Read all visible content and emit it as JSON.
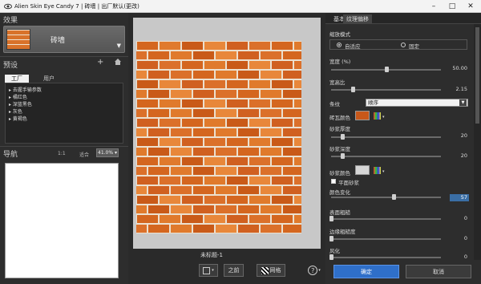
{
  "window": {
    "title": "Alien Skin Eye Candy 7 | 砖墙 | 出厂默认(更改)",
    "icons": [
      "eye-icon",
      "minimize-icon",
      "maximize-icon",
      "close-icon"
    ]
  },
  "left": {
    "effects_title": "效果",
    "effect_name": "砖墙",
    "presets_title": "预设",
    "preset_tabs": [
      "工厂",
      "用户"
    ],
    "preset_items": [
      "去握手输参数",
      "橘红色",
      "深蓝黑色",
      "灰色",
      "黄褐色"
    ],
    "nav_title": "导航",
    "nav_ratio": "1:1",
    "nav_fit": "适合",
    "nav_zoom": "41.0%"
  },
  "center": {
    "canvas_label": "未标题-1",
    "before_label": "之前",
    "grid_label": "网格",
    "help_label": "?"
  },
  "right": {
    "tabs": [
      "基本",
      "纹理偏移"
    ],
    "scale_mode_label": "缩放模式",
    "scale_options": [
      "自适应",
      "固定"
    ],
    "width_label": "宽度 (%)",
    "width_value": "50.00",
    "width_level": 0.5,
    "aspect_label": "宽高比",
    "aspect_value": "2.15",
    "aspect_level": 0.2,
    "pattern_label": "条纹",
    "pattern_value": "顺序",
    "brick_color_label": "砖瓦颜色",
    "brick_color": "#c8581a",
    "mortar_thickness_label": "砂浆厚度",
    "mortar_thickness_value": "20",
    "mortar_thickness_level": 0.1,
    "mortar_depth_label": "砂浆深度",
    "mortar_depth_value": "20",
    "mortar_depth_level": 0.1,
    "mortar_color_label": "砂浆颜色",
    "mortar_color": "#d6d6d6",
    "flat_mortar_label": "平面砂浆",
    "color_variation_label": "颜色变化",
    "color_variation_value": "57",
    "color_variation_level": 0.57,
    "surface_roughness_label": "表面粗糙",
    "surface_roughness_value": "0",
    "surface_roughness_level": 0.0,
    "edge_roughness_label": "边缘粗糙度",
    "edge_roughness_value": "0",
    "edge_roughness_level": 0.0,
    "weathering_label": "风化",
    "weathering_value": "0",
    "weathering_level": 0.0,
    "ok_label": "确定",
    "cancel_label": "取消"
  },
  "colors": {
    "accent_blue": "#2f6fc9",
    "brick": "#d8722a",
    "mortar": "#ece0cf"
  }
}
